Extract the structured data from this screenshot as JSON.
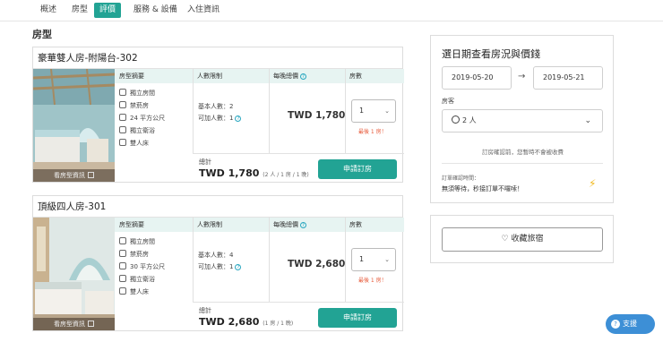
{
  "tabs": [
    "概述",
    "房型",
    "評價",
    "服務 & 設備",
    "入住資訊"
  ],
  "active_tab": "評價",
  "section_title": "房型",
  "table_headers": {
    "summary": "房型摘要",
    "occupancy": "人數限制",
    "price": "每晚總價",
    "rooms": "房數"
  },
  "photo_caption": "看房型資訊",
  "rooms": [
    {
      "name": "豪華雙人房-附陽台-302",
      "features": [
        "獨立房間",
        "禁菸房",
        "24 平方公尺",
        "獨立衛浴",
        "雙人床"
      ],
      "base_guests": "基本人數：2",
      "extra_guests": "可加人數：1",
      "price": "TWD  1,780",
      "quantity": "1",
      "left_note": "最後 1 房！",
      "total_label": "總計",
      "total": "TWD  1,780",
      "total_detail": "(2 人 / 1 房 / 1 晚)",
      "book_label": "申請訂房"
    },
    {
      "name": "頂級四人房-301",
      "features": [
        "獨立房間",
        "禁菸房",
        "30 平方公尺",
        "獨立衛浴",
        "雙人床"
      ],
      "base_guests": "基本人數：4",
      "extra_guests": "可加人數：1",
      "price": "TWD  2,680",
      "quantity": "1",
      "left_note": "最後 1 房！",
      "total_label": "總計",
      "total": "TWD  2,680",
      "total_detail": "(1 房 / 1 晚)",
      "book_label": "申請訂房"
    }
  ],
  "sidebar": {
    "title": "選日期查看房況與價錢",
    "checkin": "2019-05-20",
    "arrow": "→",
    "checkout": "2019-05-21",
    "guest_label": "房客",
    "guests": "2 人",
    "note": "訂房確認前，您暫時不會被收費",
    "confirm_label": "訂單確認時間：",
    "confirm_text": "無須等待，秒接訂單不囉嗦！",
    "favorite_label": "收藏旅宿"
  },
  "support_label": "支援",
  "colors": {
    "accent": "#22a394",
    "header_bg": "#e7f4f2",
    "warning": "#e75b3b",
    "support": "#3d8fd6"
  }
}
